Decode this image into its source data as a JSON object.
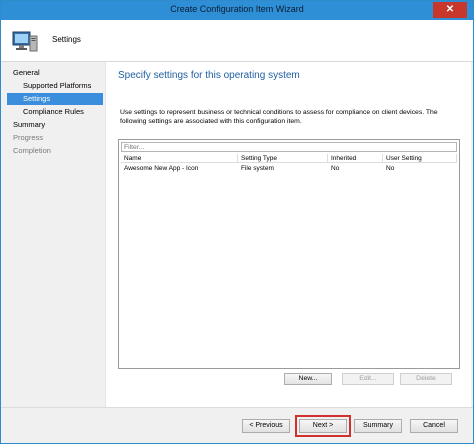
{
  "window": {
    "title": "Create Configuration Item Wizard",
    "close_glyph": "✕"
  },
  "header": {
    "icon": "computer-settings-icon",
    "title": "Settings"
  },
  "nav": {
    "items": [
      {
        "label": "General"
      },
      {
        "label": "Supported Platforms"
      },
      {
        "label": "Settings"
      },
      {
        "label": "Compliance Rules"
      },
      {
        "label": "Summary"
      },
      {
        "label": "Progress"
      },
      {
        "label": "Completion"
      }
    ]
  },
  "content": {
    "title": "Specify settings for this operating system",
    "description": "Use settings to represent business or technical conditions to assess for compliance on client devices. The following settings are associated with this configuration item.",
    "filter_placeholder": "Filter...",
    "columns": [
      "Name",
      "Setting Type",
      "Inherited",
      "User Setting"
    ],
    "rows": [
      [
        "Awesome New App - Icon",
        "File system",
        "No",
        "No"
      ]
    ],
    "buttons": {
      "new": "New...",
      "edit": "Edit...",
      "delete": "Delete"
    }
  },
  "footer": {
    "previous": "< Previous",
    "next": "Next >",
    "summary": "Summary",
    "cancel": "Cancel"
  },
  "colors": {
    "titlebar": "#2e8ed6",
    "selection": "#3b8edb",
    "title_text": "#1f5fa0",
    "highlight": "#d0312d"
  }
}
